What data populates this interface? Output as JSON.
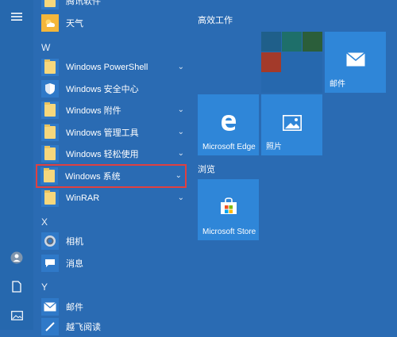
{
  "rail": {
    "menu_icon": "hamburger-icon",
    "items": [
      "user-avatar-icon",
      "document-icon",
      "pictures-icon"
    ]
  },
  "app_list": {
    "partial_top_label": "腾讯软件",
    "weather_label": "天气",
    "letters": {
      "w": "W",
      "x": "X",
      "y": "Y"
    },
    "items_w": [
      {
        "label": "Windows PowerShell",
        "expandable": true
      },
      {
        "label": "Windows 安全中心",
        "expandable": false
      },
      {
        "label": "Windows 附件",
        "expandable": true
      },
      {
        "label": "Windows 管理工具",
        "expandable": true
      },
      {
        "label": "Windows 轻松使用",
        "expandable": true
      },
      {
        "label": "Windows 系统",
        "expandable": true,
        "highlighted": true
      },
      {
        "label": "WinRAR",
        "expandable": true
      }
    ],
    "items_x": [
      {
        "label": "相机"
      },
      {
        "label": "消息"
      }
    ],
    "items_y": [
      {
        "label": "邮件"
      },
      {
        "label": "越飞阅读"
      }
    ]
  },
  "tiles": {
    "group1_title": "高效工作",
    "group2_title": "浏览",
    "mail_label": "邮件",
    "edge_label": "Microsoft Edge",
    "photos_label": "照片",
    "store_label": "Microsoft Store"
  },
  "colors": {
    "background": "#2a6bb3",
    "tile": "#2f86d8",
    "folder": "#f6d77c",
    "highlight_border": "#e04040"
  }
}
